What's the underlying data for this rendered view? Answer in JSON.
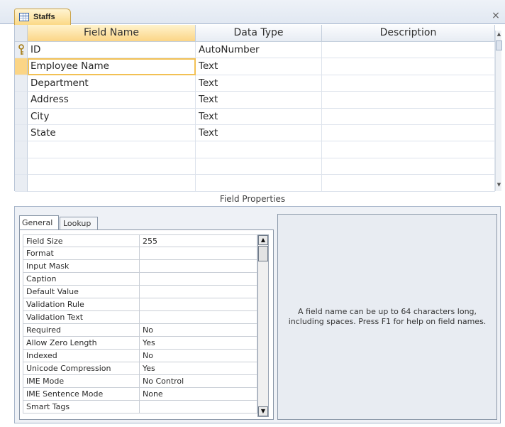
{
  "tab": {
    "title": "Staffs",
    "close_glyph": "×"
  },
  "grid": {
    "headers": {
      "field_name": "Field Name",
      "data_type": "Data Type",
      "description": "Description"
    },
    "rows": [
      {
        "name": "ID",
        "type": "AutoNumber",
        "description": "",
        "primary_key": true
      },
      {
        "name": "Employee Name",
        "type": "Text",
        "description": "",
        "active": true
      },
      {
        "name": "Department",
        "type": "Text",
        "description": ""
      },
      {
        "name": "Address",
        "type": "Text",
        "description": ""
      },
      {
        "name": "City",
        "type": "Text",
        "description": ""
      },
      {
        "name": "State",
        "type": "Text",
        "description": ""
      },
      {
        "name": "",
        "type": "",
        "description": ""
      },
      {
        "name": "",
        "type": "",
        "description": ""
      },
      {
        "name": "",
        "type": "",
        "description": ""
      }
    ]
  },
  "field_properties": {
    "label": "Field Properties",
    "tabs": {
      "general": "General",
      "lookup": "Lookup"
    },
    "properties": [
      {
        "name": "Field Size",
        "value": "255"
      },
      {
        "name": "Format",
        "value": ""
      },
      {
        "name": "Input Mask",
        "value": ""
      },
      {
        "name": "Caption",
        "value": ""
      },
      {
        "name": "Default Value",
        "value": ""
      },
      {
        "name": "Validation Rule",
        "value": ""
      },
      {
        "name": "Validation Text",
        "value": ""
      },
      {
        "name": "Required",
        "value": "No"
      },
      {
        "name": "Allow Zero Length",
        "value": "Yes"
      },
      {
        "name": "Indexed",
        "value": "No"
      },
      {
        "name": "Unicode Compression",
        "value": "Yes"
      },
      {
        "name": "IME Mode",
        "value": "No Control"
      },
      {
        "name": "IME Sentence Mode",
        "value": "None"
      },
      {
        "name": "Smart Tags",
        "value": ""
      }
    ],
    "help_text": "A field name can be up to 64 characters long, including spaces. Press F1 for help on field names."
  },
  "icons": {
    "table": "table-icon",
    "key": "primary-key-icon"
  },
  "colors": {
    "active_tab": "#fbd586",
    "active_cell_border": "#f2c154"
  }
}
